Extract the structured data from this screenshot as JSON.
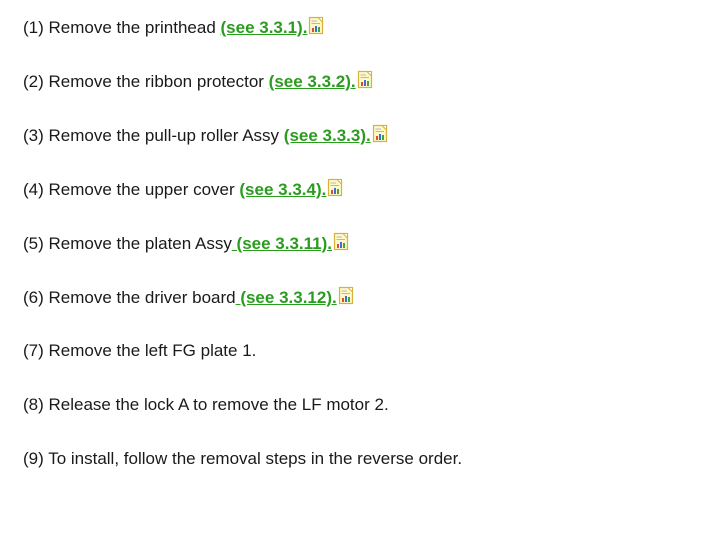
{
  "steps": [
    {
      "text": "(1) Remove the printhead ",
      "link": "(see 3.3.1).",
      "icon": "document-chart-icon"
    },
    {
      "text": "(2) Remove the ribbon protector ",
      "link": "(see 3.3.2).",
      "icon": "document-chart-icon"
    },
    {
      "text": "(3) Remove the pull-up roller Assy ",
      "link": "(see 3.3.3).",
      "icon": "document-chart-icon"
    },
    {
      "text": "(4) Remove the upper cover ",
      "link": "(see 3.3.4).",
      "icon": "document-chart-icon"
    },
    {
      "text": "(5) Remove the platen Assy",
      "link": " (see 3.3.11).",
      "icon": "document-chart-icon"
    },
    {
      "text": "(6) Remove the driver board",
      "link": " (see 3.3.12).",
      "icon": "document-chart-icon"
    },
    {
      "text": "(7) Remove the left FG plate 1."
    },
    {
      "text": "(8) Release the lock A to remove the LF motor 2."
    },
    {
      "text": "(9) To install, follow the removal steps in the reverse order."
    }
  ],
  "colors": {
    "link": "#2a9d1f",
    "text": "#1a1a1a",
    "icon_page": "#fff8c8",
    "icon_border": "#d6b13c"
  }
}
